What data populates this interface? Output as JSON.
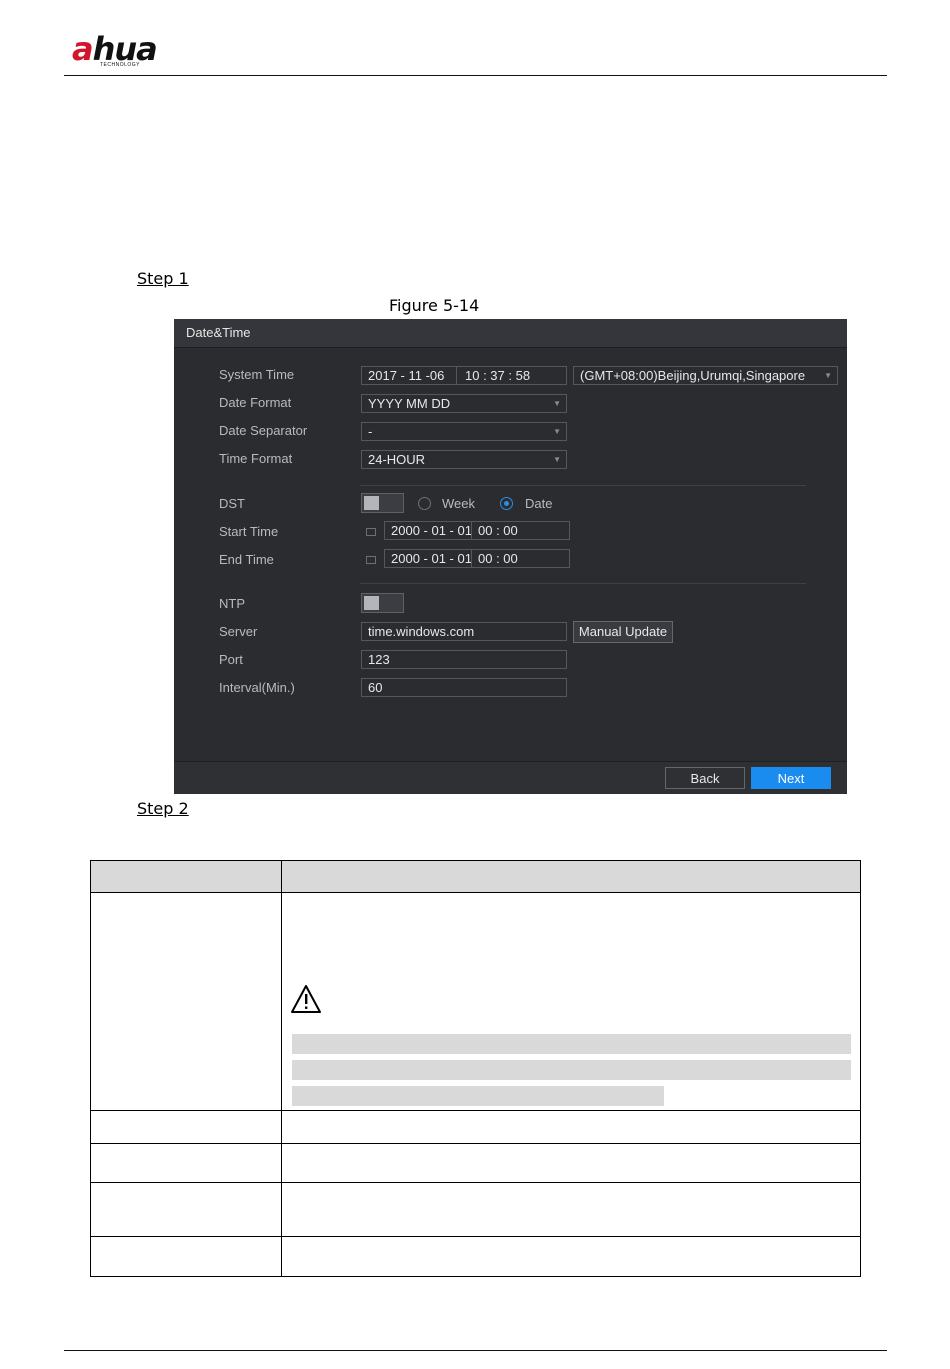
{
  "header": {
    "logo_main_prefix": "a",
    "logo_main_suffix": "hua",
    "logo_sub": "TECHNOLOGY"
  },
  "step1_label": "Step 1",
  "figure_caption": "Figure 5-14",
  "step2_label": "Step 2",
  "panel": {
    "title": "Date&Time",
    "system_time": {
      "label": "System Time",
      "date": "2017 - 11 -06",
      "time": "10 : 37 : 58",
      "timezone": "(GMT+08:00)Beijing,Urumqi,Singapore"
    },
    "date_format": {
      "label": "Date Format",
      "value": "YYYY MM DD"
    },
    "date_separator": {
      "label": "Date Separator",
      "value": "-"
    },
    "time_format": {
      "label": "Time Format",
      "value": "24-HOUR"
    },
    "dst": {
      "label": "DST",
      "option_week": "Week",
      "option_date": "Date",
      "selected": "Date"
    },
    "start_time": {
      "label": "Start Time",
      "date": "2000 - 01 - 01",
      "time": "00 : 00"
    },
    "end_time": {
      "label": "End Time",
      "date": "2000 - 01 - 01",
      "time": "00 : 00"
    },
    "ntp": {
      "label": "NTP"
    },
    "server": {
      "label": "Server",
      "value": "time.windows.com",
      "button": "Manual Update"
    },
    "port": {
      "label": "Port",
      "value": "123"
    },
    "interval": {
      "label": "Interval(Min.)",
      "value": "60"
    },
    "back_button": "Back",
    "next_button": "Next",
    "colors": {
      "accent": "#1a8cf0",
      "background": "#2b2c30"
    }
  }
}
